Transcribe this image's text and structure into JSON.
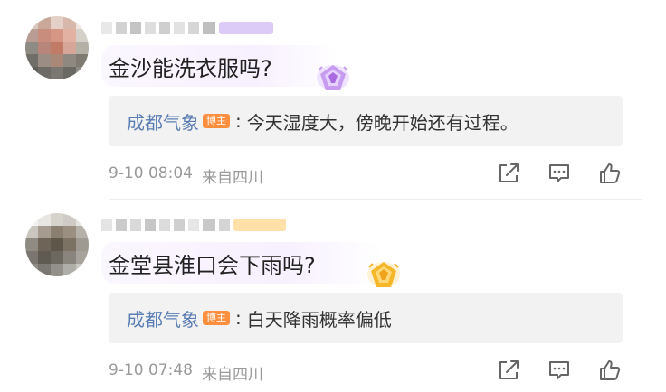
{
  "comments": [
    {
      "question": "金沙能洗衣服吗?",
      "reply": {
        "author": "成都气象",
        "badge": "博主",
        "separator": ":",
        "text": "今天湿度大，傍晚开始还有过程。"
      },
      "timestamp": "9-10 08:04",
      "location": "来自四川",
      "medal": "purple-gem-icon",
      "tag_color": "#d9c8f5"
    },
    {
      "question": "金堂县淮口会下雨吗?",
      "reply": {
        "author": "成都气象",
        "badge": "博主",
        "separator": ":",
        "text": "白天降雨概率偏低"
      },
      "timestamp": "9-10 07:48",
      "location": "来自四川",
      "medal": "gold-gem-icon",
      "tag_color": "#ffe0a8"
    }
  ],
  "colors": {
    "author": "#5a7db3",
    "badge": "#ff8f3f",
    "reply_bg": "#f2f2f2",
    "meta": "#999999"
  }
}
